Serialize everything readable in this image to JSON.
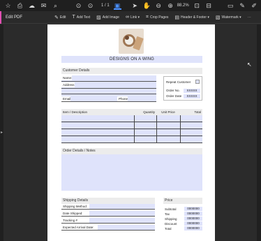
{
  "toolbar": {
    "page_current": "1",
    "page_total": "/ 1",
    "zoom": "88.2%"
  },
  "edit_bar": {
    "title": "Edit PDF",
    "items": [
      {
        "label": "Edit",
        "icon": "edit-icon"
      },
      {
        "label": "Add Text",
        "icon": "add-text-icon"
      },
      {
        "label": "Add Image",
        "icon": "add-image-icon"
      },
      {
        "label": "Link ▾",
        "icon": "link-icon"
      },
      {
        "label": "Crop Pages",
        "icon": "crop-icon"
      },
      {
        "label": "Header & Footer ▾",
        "icon": "header-footer-icon"
      },
      {
        "label": "Watermark ▾",
        "icon": "watermark-icon"
      }
    ]
  },
  "document": {
    "company": "DESIGNS ON A WING",
    "customer_details": {
      "header": "Customer Details",
      "name_label": "Name:",
      "address_label": "Address",
      "email_label": "Email",
      "phone_label": "Phone"
    },
    "repeat_box": {
      "repeat_label": "Repeat Customer",
      "order_no_label": "Order No.",
      "order_no_value": "XXXXX",
      "order_date_label": "Order Date",
      "order_date_value": "XXXXX"
    },
    "items_table": {
      "columns": [
        "Item / Description",
        "Quantity",
        "Unit Price",
        "Total"
      ]
    },
    "notes": {
      "header": "Order Details / Notes"
    },
    "shipping": {
      "header": "Shipping Details",
      "rows": [
        "Shipping Method:",
        "Date Shipped:",
        "Tracking #",
        "Expected Arrival Date:"
      ]
    },
    "price": {
      "header": "Price",
      "rows": [
        {
          "label": "Subtotal",
          "value": "0000000"
        },
        {
          "label": "Tax",
          "value": "0000000"
        },
        {
          "label": "Shipping",
          "value": "0000000"
        },
        {
          "label": "Discount",
          "value": "0000000"
        },
        {
          "label": "Total",
          "value": "0000000"
        }
      ]
    }
  }
}
